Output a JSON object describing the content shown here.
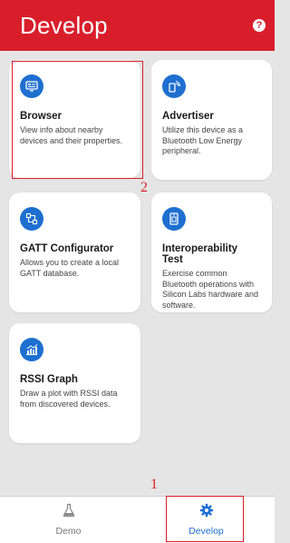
{
  "header": {
    "title": "Develop",
    "help_icon": "help-icon"
  },
  "cards": [
    {
      "id": "browser",
      "title": "Browser",
      "description": "View info about nearby devices and their properties.",
      "icon": "browser-icon"
    },
    {
      "id": "advertiser",
      "title": "Advertiser",
      "description": "Utilize this device as a Bluetooth Low Energy peripheral.",
      "icon": "advertiser-icon"
    },
    {
      "id": "gatt",
      "title": "GATT Configurator",
      "description": "Allows you to create a local GATT database.",
      "icon": "gatt-icon"
    },
    {
      "id": "interop",
      "title": "Interoperability Test",
      "description": "Exercise common Bluetooth operations with Silicon Labs hardware and software.",
      "icon": "interop-icon"
    },
    {
      "id": "rssi",
      "title": "RSSI Graph",
      "description": "Draw a plot with RSSI data from discovered devices.",
      "icon": "rssi-graph-icon"
    }
  ],
  "bottom_nav": {
    "items": [
      {
        "label": "Demo",
        "icon": "flask-icon",
        "active": false
      },
      {
        "label": "Develop",
        "icon": "gear-icon",
        "active": true
      }
    ]
  },
  "annotations": {
    "marker_1": "1",
    "marker_2": "2"
  },
  "colors": {
    "header": "#d91e2b",
    "accent_blue": "#1e6fd0",
    "background": "#e5e5e5",
    "annotation": "#d91e2b"
  }
}
